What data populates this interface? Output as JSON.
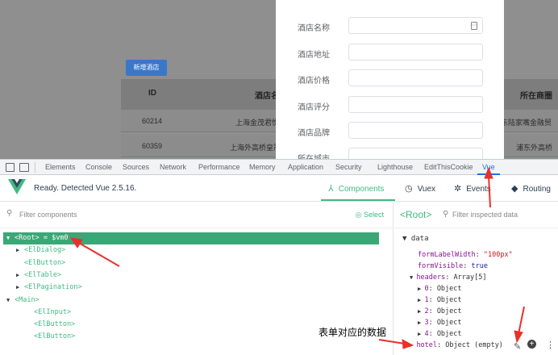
{
  "page": {
    "add_button": "新增酒店",
    "table_headers": [
      "ID",
      "酒店名",
      "所在商圈"
    ],
    "rows": [
      {
        "id": "60214",
        "name": "上海金茂君悦",
        "area": "浦东陆家嘴金融贸"
      },
      {
        "id": "60359",
        "name": "上海外高桥皇冠",
        "area": "浦东外高桥"
      }
    ]
  },
  "dialog": {
    "fields": [
      "酒店名称",
      "酒店地址",
      "酒店价格",
      "酒店评分",
      "酒店品牌",
      "所在城市"
    ]
  },
  "devtools": {
    "tabs": [
      "Elements",
      "Console",
      "Sources",
      "Network",
      "Performance",
      "Memory",
      "Application",
      "Security",
      "Lighthouse",
      "EditThisCookie",
      "Vue"
    ],
    "active_tab": "Vue"
  },
  "vue": {
    "status": "Ready. Detected Vue 2.5.16.",
    "nav": [
      "Components",
      "Vuex",
      "Events",
      "Routing"
    ],
    "nav_icons": [
      "components-icon",
      "vuex-icon",
      "events-icon",
      "routing-icon"
    ],
    "filter_placeholder": "Filter components",
    "select_label": "Select",
    "tree": [
      {
        "arrow": "▼",
        "tag": "<Root>",
        "extra": " = $vm0",
        "selected": true,
        "indent": 0
      },
      {
        "arrow": "▶",
        "tag": "<ElDialog>",
        "extra": "",
        "selected": false,
        "indent": 1
      },
      {
        "arrow": "",
        "tag": "<ElButton>",
        "extra": "",
        "selected": false,
        "indent": 1
      },
      {
        "arrow": "▶",
        "tag": "<ElTable>",
        "extra": "",
        "selected": false,
        "indent": 1
      },
      {
        "arrow": "▶",
        "tag": "<ElPagination>",
        "extra": "",
        "selected": false,
        "indent": 1
      },
      {
        "arrow": "▼",
        "tag": "<Main>",
        "extra": "",
        "selected": false,
        "indent": 0
      },
      {
        "arrow": "",
        "tag": "<ElInput>",
        "extra": "",
        "selected": false,
        "indent": 2
      },
      {
        "arrow": "",
        "tag": "<ElButton>",
        "extra": "",
        "selected": false,
        "indent": 2
      },
      {
        "arrow": "",
        "tag": "<ElButton>",
        "extra": "",
        "selected": false,
        "indent": 2
      }
    ],
    "inspector": {
      "crumb": "<Root>",
      "filter_placeholder": "Filter inspected data",
      "section": "▼ data",
      "props": [
        {
          "indent": 0,
          "arrow": "",
          "key": "formLabelWidth",
          "value": "\"100px\"",
          "type": "str"
        },
        {
          "indent": 0,
          "arrow": "",
          "key": "formVisible",
          "value": "true",
          "type": "bool"
        },
        {
          "indent": 0,
          "arrow": "▼ ",
          "key": "headers",
          "value": "Array[5]",
          "type": "plain"
        },
        {
          "indent": 1,
          "arrow": "▶ ",
          "key": "0",
          "value": "Object",
          "type": "plain"
        },
        {
          "indent": 1,
          "arrow": "▶ ",
          "key": "1",
          "value": "Object",
          "type": "plain"
        },
        {
          "indent": 1,
          "arrow": "▶ ",
          "key": "2",
          "value": "Object",
          "type": "plain"
        },
        {
          "indent": 1,
          "arrow": "▶ ",
          "key": "3",
          "value": "Object",
          "type": "plain"
        },
        {
          "indent": 1,
          "arrow": "▶ ",
          "key": "4",
          "value": "Object",
          "type": "plain"
        },
        {
          "indent": 0,
          "arrow": "▶ ",
          "key": "hotel",
          "value": "Object (empty)",
          "type": "plain"
        }
      ]
    }
  },
  "annotation": "表单对应的数据",
  "colors": {
    "vue_green": "#42b983",
    "selected_row": "#3ba776",
    "arrow_red": "#e8312a",
    "devtools_blue": "#1a73e8"
  }
}
